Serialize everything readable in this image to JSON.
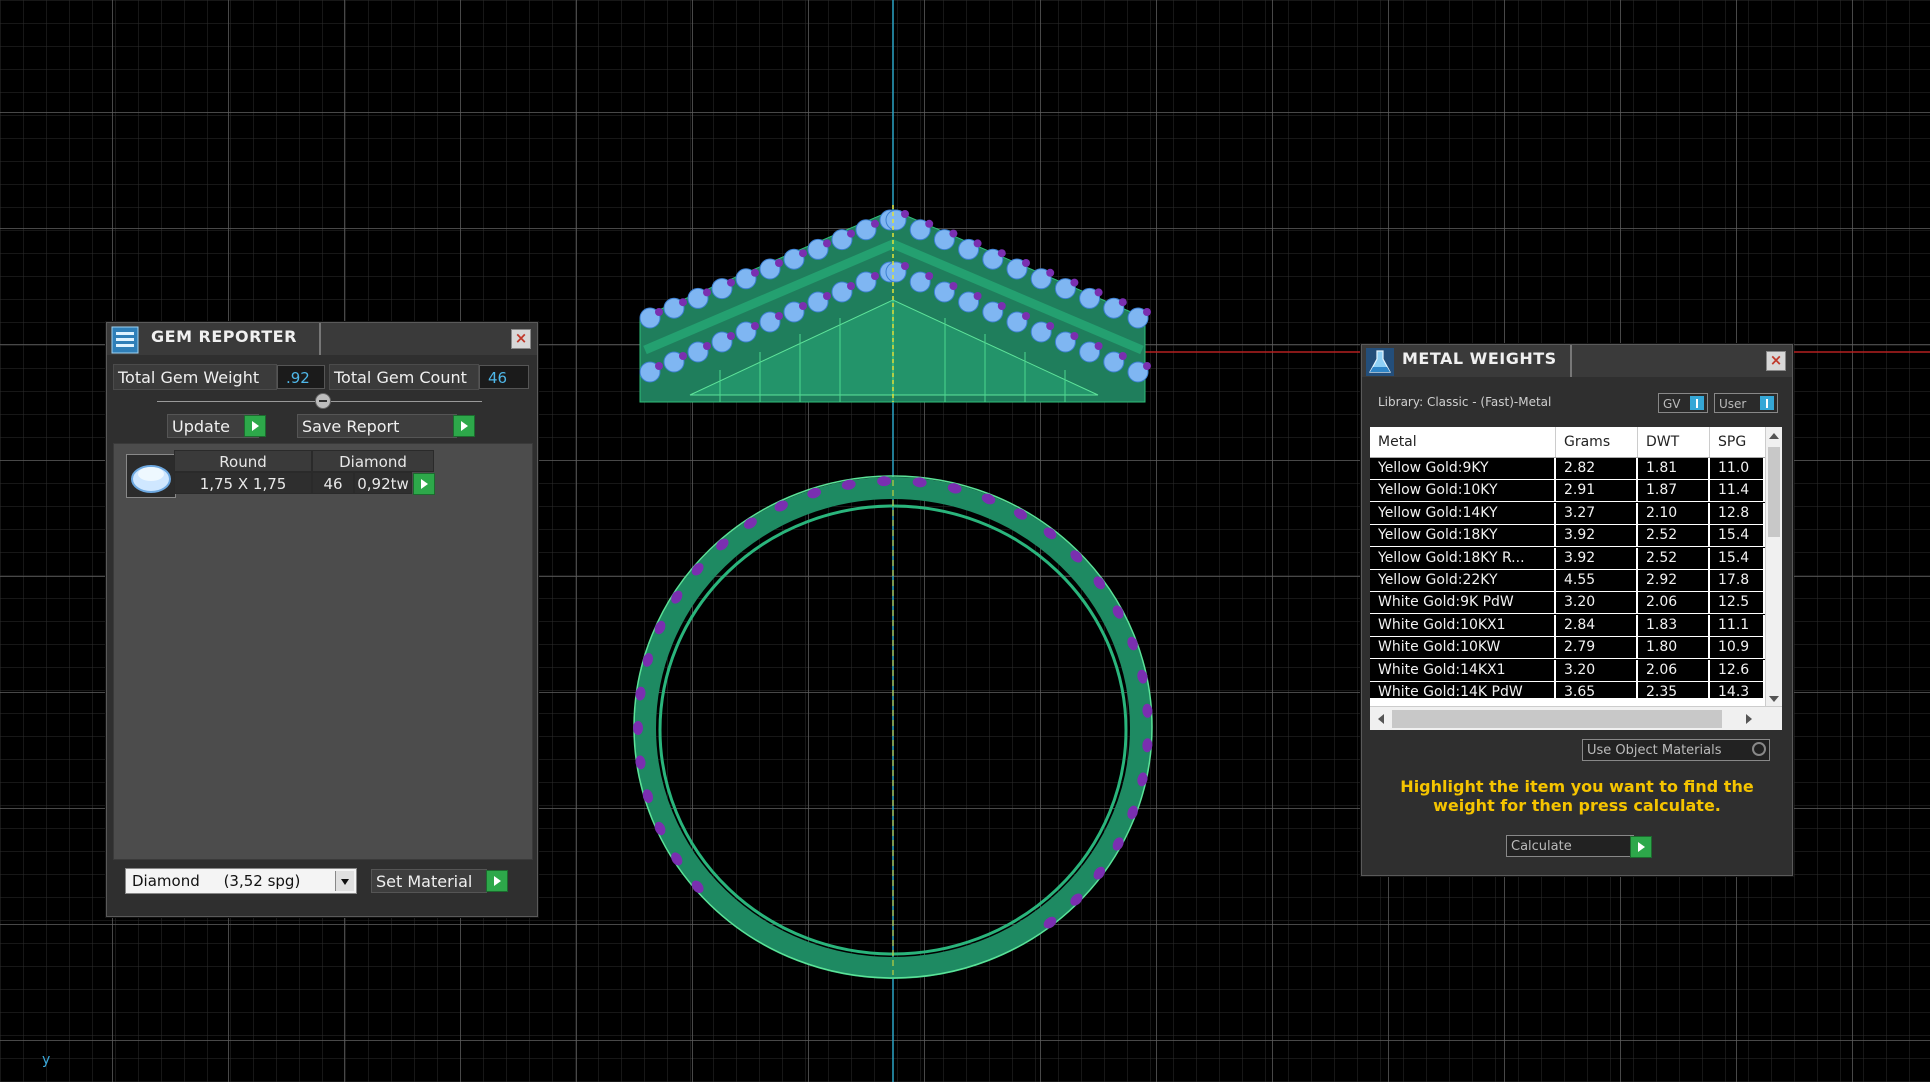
{
  "gem_reporter": {
    "title": "GEM REPORTER",
    "total_gem_weight_label": "Total Gem Weight",
    "total_gem_weight_value": ".92",
    "total_gem_count_label": "Total Gem Count",
    "total_gem_count_value": "46",
    "update_label": "Update",
    "save_report_label": "Save Report",
    "gem_row": {
      "shape": "Round",
      "stone": "Diamond",
      "size": "1,75 X 1,75",
      "count": "46",
      "weight": "0,92tw"
    },
    "material_select": "Diamond     (3,52 spg)",
    "set_material_label": "Set Material"
  },
  "metal_weights": {
    "title": "METAL WEIGHTS",
    "library_label": "Library: Classic - (Fast)-Metal",
    "gv_label": "GV",
    "user_label": "User",
    "columns": [
      "Metal",
      "Grams",
      "DWT",
      "SPG"
    ],
    "rows": [
      [
        "Yellow Gold:9KY",
        "2.82",
        "1.81",
        "11.0"
      ],
      [
        "Yellow Gold:10KY",
        "2.91",
        "1.87",
        "11.4"
      ],
      [
        "Yellow Gold:14KY",
        "3.27",
        "2.10",
        "12.8"
      ],
      [
        "Yellow Gold:18KY",
        "3.92",
        "2.52",
        "15.4"
      ],
      [
        "Yellow Gold:18KY R...",
        "3.92",
        "2.52",
        "15.4"
      ],
      [
        "Yellow Gold:22KY",
        "4.55",
        "2.92",
        "17.8"
      ],
      [
        "White Gold:9K PdW",
        "3.20",
        "2.06",
        "12.5"
      ],
      [
        "White Gold:10KX1",
        "2.84",
        "1.83",
        "11.1"
      ],
      [
        "White Gold:10KW",
        "2.79",
        "1.80",
        "10.9"
      ],
      [
        "White Gold:14KX1",
        "3.20",
        "2.06",
        "12.6"
      ],
      [
        "White Gold:14K PdW",
        "3.65",
        "2.35",
        "14.3"
      ]
    ],
    "use_object_materials_label": "Use Object Materials",
    "hint_text": "Highlight the item you want to find the weight for then press calculate.",
    "calculate_label": "Calculate"
  },
  "colors": {
    "viewport_bg": "#000000",
    "grid": "#3c3c3c",
    "grid_major": "#6a6a6a",
    "metal_green": "#1f8c64",
    "gem_blue": "#7fb6f2",
    "prong_purple": "#7a2fb0",
    "hint_yellow": "#f5c400",
    "accent_blue": "#35a7d6",
    "button_green": "#2da84a"
  },
  "icons": {
    "gem_reporter": "gem-reporter-icon",
    "metal_weights": "flask-icon",
    "close": "close-icon",
    "play": "play-icon",
    "dropdown": "chevron-down-icon"
  },
  "axis_label": "y"
}
